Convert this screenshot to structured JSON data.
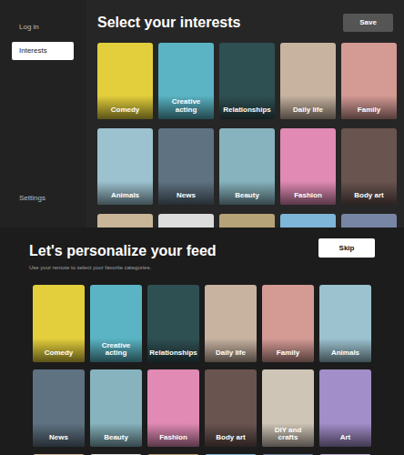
{
  "top": {
    "sidebar": {
      "items": [
        {
          "label": "Log in",
          "selected": false
        },
        {
          "label": "Interests",
          "selected": true
        }
      ],
      "footer_items": [
        {
          "label": "Settings",
          "selected": false
        }
      ]
    },
    "title": "Select your interests",
    "save_button": "Save",
    "cards": [
      {
        "label": "Comedy",
        "color": "#e3cf3c"
      },
      {
        "label": "Creative acting",
        "color": "#5ab4c4"
      },
      {
        "label": "Relationships",
        "color": "#2f5053"
      },
      {
        "label": "Daily life",
        "color": "#c7b3a0"
      },
      {
        "label": "Family",
        "color": "#d49a94"
      },
      {
        "label": "Animals",
        "color": "#9cc2cf"
      },
      {
        "label": "News",
        "color": "#5f7282"
      },
      {
        "label": "Beauty",
        "color": "#86b3bd"
      },
      {
        "label": "Fashion",
        "color": "#e08ab4"
      },
      {
        "label": "Body art",
        "color": "#6a5450"
      }
    ],
    "partial_cards": [
      {
        "color": "#c9b598"
      },
      {
        "color": "#dcdcdc"
      },
      {
        "color": "#b7a378"
      },
      {
        "color": "#7db6d8"
      },
      {
        "color": "#7786a4"
      }
    ]
  },
  "bottom": {
    "title": "Let's personalize your feed",
    "subtitle": "Use your remote to select your favorite categories.",
    "skip_button": "Skip",
    "cards": [
      {
        "label": "Comedy",
        "color": "#e3cf3c"
      },
      {
        "label": "Creative acting",
        "color": "#5ab4c4"
      },
      {
        "label": "Relationships",
        "color": "#2f5053"
      },
      {
        "label": "Daily life",
        "color": "#c7b3a0"
      },
      {
        "label": "Family",
        "color": "#d49a94"
      },
      {
        "label": "Animals",
        "color": "#9cc2cf"
      },
      {
        "label": "News",
        "color": "#5f7282"
      },
      {
        "label": "Beauty",
        "color": "#86b3bd"
      },
      {
        "label": "Fashion",
        "color": "#e08ab4"
      },
      {
        "label": "Body art",
        "color": "#6a5450"
      },
      {
        "label": "DIY and crafts",
        "color": "#cfc5b6"
      },
      {
        "label": "Art",
        "color": "#a28ec9"
      }
    ],
    "partial_cards": [
      {
        "color": "#c9b598"
      },
      {
        "color": "#dcdcdc"
      },
      {
        "color": "#b7a378"
      },
      {
        "color": "#7db6d8"
      },
      {
        "color": "#7786a4"
      },
      {
        "color": "#b9a9c9"
      }
    ]
  }
}
